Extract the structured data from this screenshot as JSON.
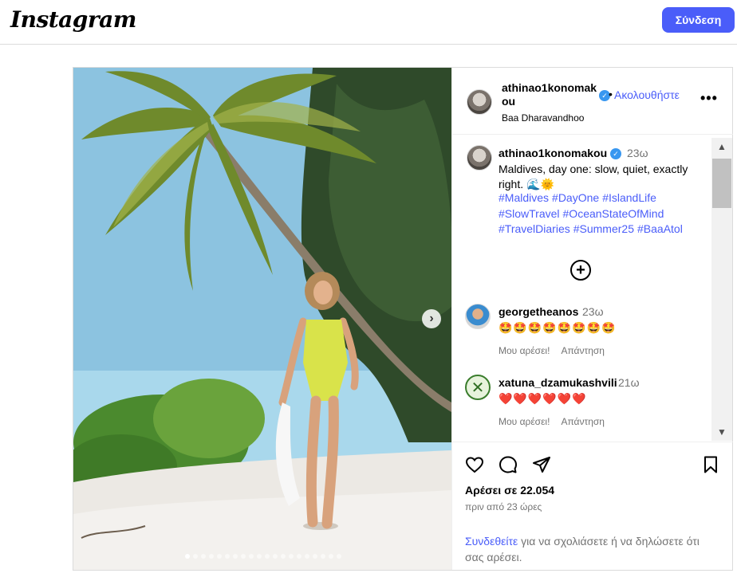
{
  "header": {
    "logo": "Instagram",
    "login_button": "Σύνδεση"
  },
  "post": {
    "author": {
      "username": "athinao1konomakou",
      "username_wrapped_line1": "athinao1konomak",
      "username_wrapped_line2": "ou",
      "follow_label": "Ακολουθήστε",
      "location": "Baa Dharavandhoo",
      "more_icon": "more-horizontal-icon"
    },
    "caption": {
      "username": "athinao1konomakou",
      "time": "23ω",
      "text": "Maldives, day one: slow, quiet, exactly right. 🌊🌞",
      "hashtags": [
        "#Maldives",
        "#DayOne",
        "#IslandLife",
        "#SlowTravel",
        "#OceanStateOfMind",
        "#TravelDiaries",
        "#Summer25",
        "#BaaAtol"
      ]
    },
    "load_more_icon": "plus-circle-icon",
    "comments": [
      {
        "username": "georgetheanos",
        "time": "23ω",
        "text": "🤩🤩🤩🤩🤩🤩🤩🤩",
        "like_label": "Μου αρέσει!",
        "reply_label": "Απάντηση"
      },
      {
        "username": "xatuna_dzamukashvili",
        "time": "21ω",
        "text": "❤️❤️❤️❤️❤️❤️",
        "like_label": "Μου αρέσει!",
        "reply_label": "Απάντηση"
      }
    ],
    "likes_text": "Αρέσει σε 22.054",
    "time_ago": "πριν από 23 ώρες",
    "login_prompt": {
      "link": "Συνδεθείτε",
      "rest": " για να σχολιάσετε ή να δηλώσετε ότι σας αρέσει."
    },
    "carousel": {
      "total_slides": 20,
      "active_slide": 1
    }
  },
  "colors": {
    "accent": "#4a5df9",
    "verified": "#3897f0",
    "muted": "#737373"
  }
}
